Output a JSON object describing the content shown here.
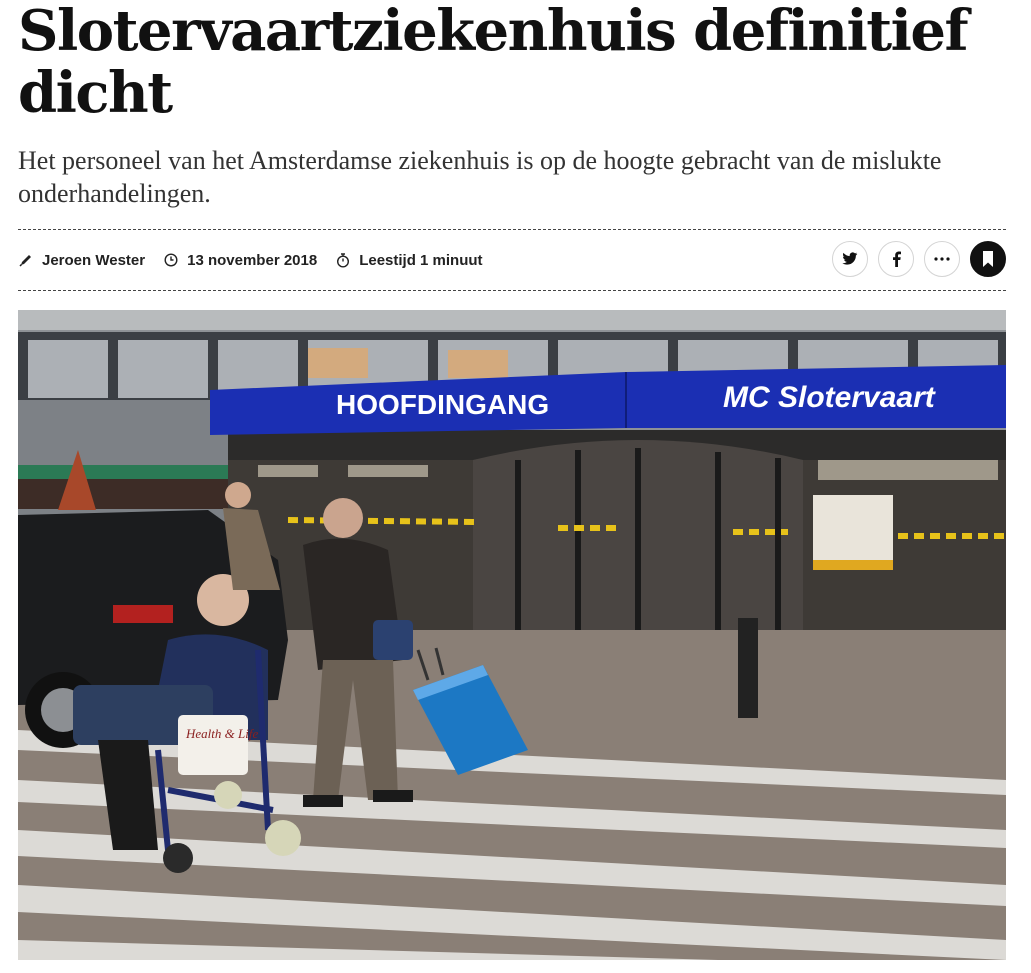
{
  "article": {
    "headline": "Slotervaartziekenhuis definitief dicht",
    "lead": "Het personeel van het Amsterdamse ziekenhuis is op de hoogte gebracht van de mislukte onderhandelingen.",
    "author": "Jeroen Wester",
    "date": "13 november 2018",
    "reading_time": "Leestijd 1 minuut"
  },
  "icons": {
    "author": "pen-icon",
    "date": "clock-icon",
    "reading_time": "stopwatch-icon",
    "twitter": "twitter-icon",
    "facebook": "facebook-icon",
    "more": "more-icon",
    "bookmark": "bookmark-icon"
  },
  "photo": {
    "sign_left": "HOOFDINGANG",
    "sign_right": "MC Slotervaart",
    "walker_label": "Health & Life"
  },
  "colors": {
    "sign_blue": "#1b2fb3",
    "text": "#1a1a1a"
  }
}
